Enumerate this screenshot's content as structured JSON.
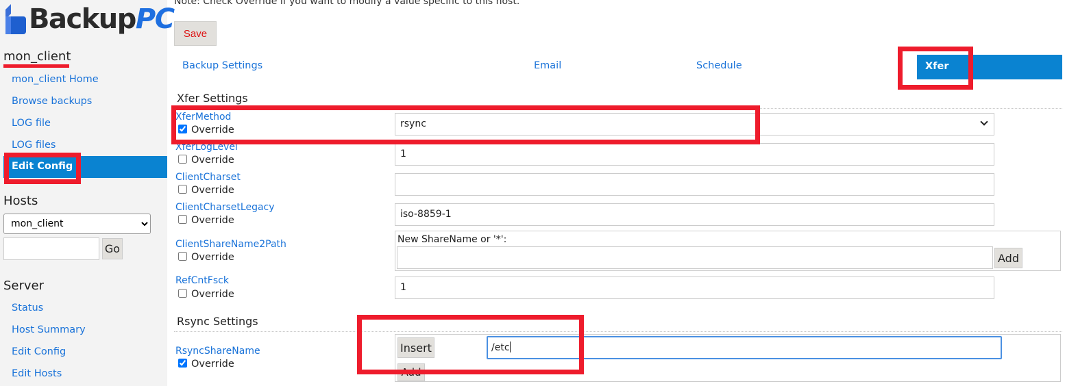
{
  "logo": {
    "part1": "Backup",
    "part2": "PC"
  },
  "sidebar": {
    "host_title": "mon_client",
    "host_links": [
      "mon_client Home",
      "Browse backups",
      "LOG file",
      "LOG files"
    ],
    "active_item": "Edit Config",
    "hosts_heading": "Hosts",
    "hosts_selected": "mon_client",
    "go_label": "Go",
    "server_heading": "Server",
    "server_links": [
      "Status",
      "Host Summary",
      "Edit Config",
      "Edit Hosts"
    ]
  },
  "main": {
    "note": "Note: Check Override if you want to modify a value specific to this host.",
    "save_label": "Save",
    "tabs": [
      {
        "label": "Backup Settings",
        "active": false
      },
      {
        "label": "Email",
        "active": false
      },
      {
        "label": "Schedule",
        "active": false
      },
      {
        "label": "Xfer",
        "active": true
      }
    ],
    "xfer_section": "Xfer Settings",
    "fields": [
      {
        "label": "XferMethod",
        "override_label": "Override",
        "override": true,
        "value": "rsync",
        "type": "select"
      },
      {
        "label": "XferLogLevel",
        "override_label": "Override",
        "override": false,
        "value": "1",
        "type": "text"
      },
      {
        "label": "ClientCharset",
        "override_label": "Override",
        "override": false,
        "value": "",
        "type": "text"
      },
      {
        "label": "ClientCharsetLegacy",
        "override_label": "Override",
        "override": false,
        "value": "iso-8859-1",
        "type": "text"
      },
      {
        "label": "ClientShareName2Path",
        "override_label": "Override",
        "override": false,
        "type": "hash",
        "new_name_label": "New ShareName or '*':",
        "new_name_value": "",
        "add_label": "Add"
      },
      {
        "label": "RefCntFsck",
        "override_label": "Override",
        "override": false,
        "value": "1",
        "type": "text"
      }
    ],
    "rsync_section": "Rsync Settings",
    "rsync_share": {
      "label": "RsyncShareName",
      "override_label": "Override",
      "override": true,
      "insert_label": "Insert",
      "value": "/etc",
      "add_label": "Add"
    }
  },
  "colors": {
    "accent": "#0a83d1",
    "link": "#1a73d9",
    "annotation_red": "#ee1c2c",
    "save_text": "#dd1111"
  }
}
